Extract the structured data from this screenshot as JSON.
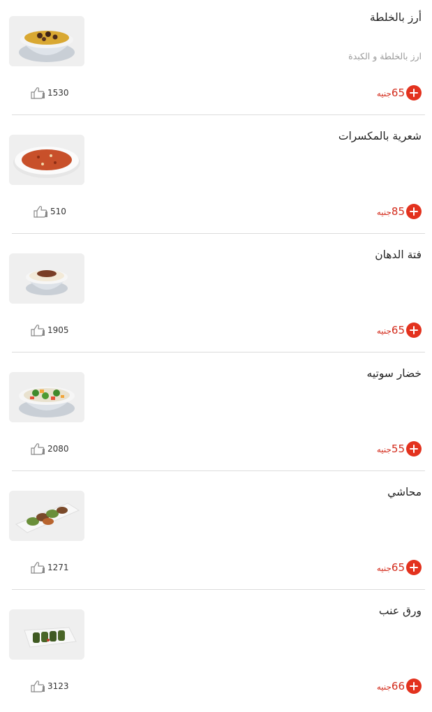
{
  "menu": {
    "items": [
      {
        "name": "أرز بالخلطة",
        "description": "ارز بالخلطة و الكبدة",
        "price": "65",
        "currency": "جنيه",
        "likes": "1530",
        "dish": "rice-bowl-icon"
      },
      {
        "name": "شعرية بالمكسرات",
        "description": "",
        "price": "85",
        "currency": "جنيه",
        "likes": "510",
        "dish": "vermicelli-plate-icon"
      },
      {
        "name": "فتة الدهان",
        "description": "",
        "price": "65",
        "currency": "جنيه",
        "likes": "1905",
        "dish": "fattah-bowl-icon"
      },
      {
        "name": "خضار سوتيه",
        "description": "",
        "price": "55",
        "currency": "جنيه",
        "likes": "2080",
        "dish": "vegetables-bowl-icon"
      },
      {
        "name": "محاشي",
        "description": "",
        "price": "65",
        "currency": "جنيه",
        "likes": "1271",
        "dish": "stuffed-veg-platter-icon"
      },
      {
        "name": "ورق عنب",
        "description": "",
        "price": "66",
        "currency": "جنيه",
        "likes": "3123",
        "dish": "grape-leaves-tray-icon"
      }
    ]
  },
  "colors": {
    "accent": "#e3321e",
    "price_text": "#d32a1a",
    "description_text": "#9a9a9a",
    "divider": "#dcdcdc"
  },
  "icons": {
    "add": "plus-circle-icon",
    "like": "thumbs-up-icon"
  }
}
